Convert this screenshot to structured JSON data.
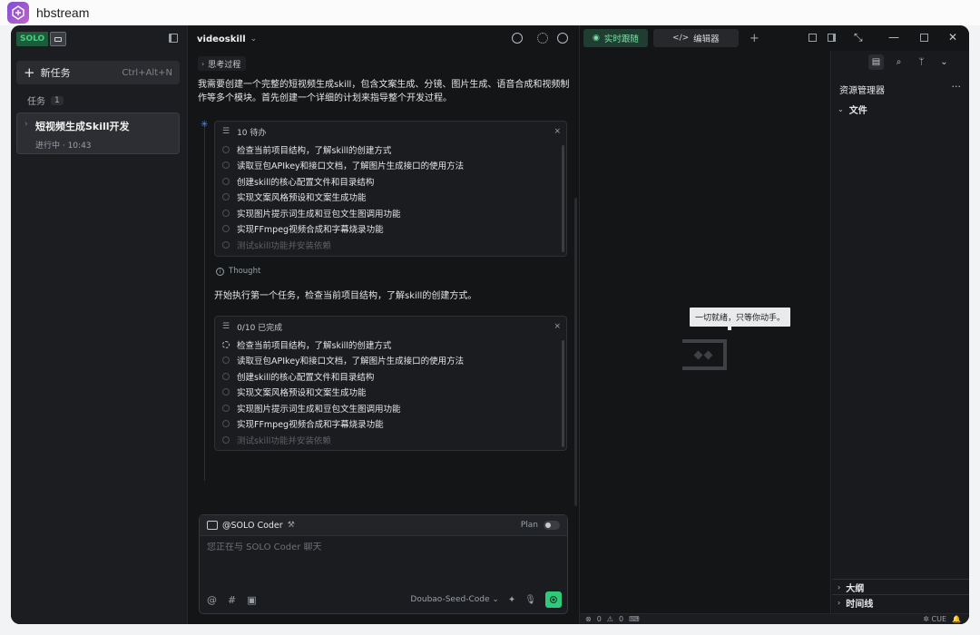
{
  "app": {
    "name": "hbstream"
  },
  "sidebar": {
    "badge": "SOLO",
    "new_task": {
      "label": "新任务",
      "shortcut": "Ctrl+Alt+N"
    },
    "tasks_section": {
      "label": "任务",
      "count": "1"
    },
    "tasks": [
      {
        "title": "短视频生成Skill开发",
        "status": "进行中 · 10:43"
      }
    ]
  },
  "chat": {
    "title": "videoskill",
    "thinking_label": "思考过程",
    "intro": "我需要创建一个完整的短视频生成skill，包含文案生成、分镜、图片生成、语音合成和视频制作等多个模块。首先创建一个详细的计划来指导整个开发过程。",
    "todo1": {
      "header": "10 待办",
      "items": [
        "检查当前项目结构，了解skill的创建方式",
        "读取豆包APIkey和接口文档，了解图片生成接口的使用方法",
        "创建skill的核心配置文件和目录结构",
        "实现文案风格预设和文案生成功能",
        "实现图片提示词生成和豆包文生图调用功能",
        "实现FFmpeg视频合成和字幕烧录功能",
        "测试skill功能并安装依赖"
      ]
    },
    "thought_label": "Thought",
    "thought_text": "开始执行第一个任务，检查当前项目结构，了解skill的创建方式。",
    "todo2": {
      "header": "0/10 已完成",
      "items": [
        "检查当前项目结构，了解skill的创建方式",
        "读取豆包APIkey和接口文档，了解图片生成接口的使用方法",
        "创建skill的核心配置文件和目录结构",
        "实现文案风格预设和文案生成功能",
        "实现图片提示词生成和豆包文生图调用功能",
        "实现FFmpeg视频合成和字幕烧录功能",
        "测试skill功能并安装依赖"
      ]
    },
    "composer": {
      "agent": "@SOLO Coder",
      "plan_label": "Plan",
      "placeholder": "您正在与 SOLO Coder 聊天",
      "model": "Doubao-Seed-Code"
    }
  },
  "workspace": {
    "tabs": [
      {
        "label": "实时跟随",
        "icon": "follow-icon"
      },
      {
        "label": "编辑器",
        "icon": "code-icon"
      }
    ],
    "bubble": "一切就绪，只等你动手。",
    "explorer": {
      "title": "资源管理器",
      "files_label": "文件",
      "outline_label": "大纲",
      "timeline_label": "时间线"
    },
    "statusbar": {
      "errors": "0",
      "warnings": "0",
      "cue": "CUE"
    }
  }
}
